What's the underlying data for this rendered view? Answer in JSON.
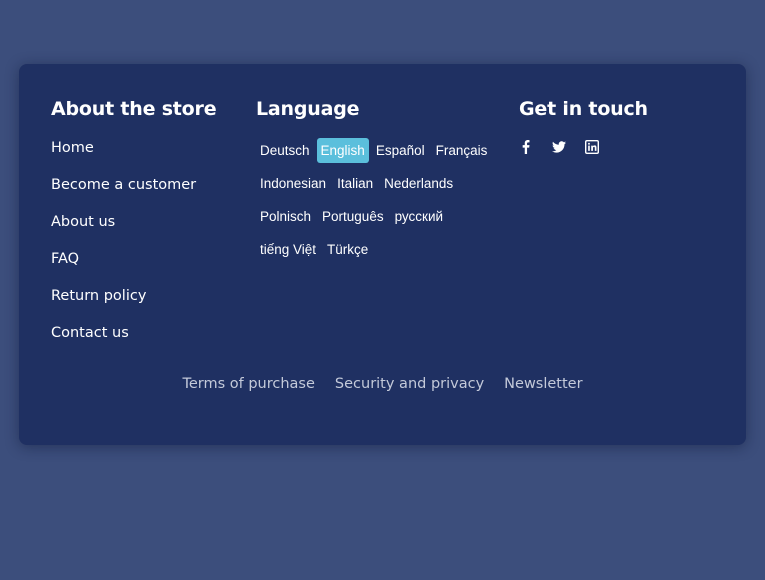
{
  "about": {
    "title": "About the store",
    "links": [
      "Home",
      "Become a customer",
      "About us",
      "FAQ",
      "Return policy",
      "Contact us"
    ]
  },
  "language": {
    "title": "Language",
    "rows": [
      [
        "Deutsch",
        "English",
        "Español",
        "Français"
      ],
      [
        "Indonesian",
        "Italian",
        "Nederlands"
      ],
      [
        "Polnisch",
        "Português",
        "русский"
      ],
      [
        "tiếng Việt",
        "Türkçe"
      ]
    ],
    "selected": "English",
    "selected_color": "#5bbfdc"
  },
  "contact": {
    "title": "Get in touch",
    "icons": [
      "facebook-icon",
      "twitter-icon",
      "linkedin-icon"
    ]
  },
  "bottom_links": [
    "Terms of purchase",
    "Security and privacy",
    "Newsletter"
  ],
  "colors": {
    "page_background": "#3c4e7c",
    "card_background": "#1f3062"
  }
}
